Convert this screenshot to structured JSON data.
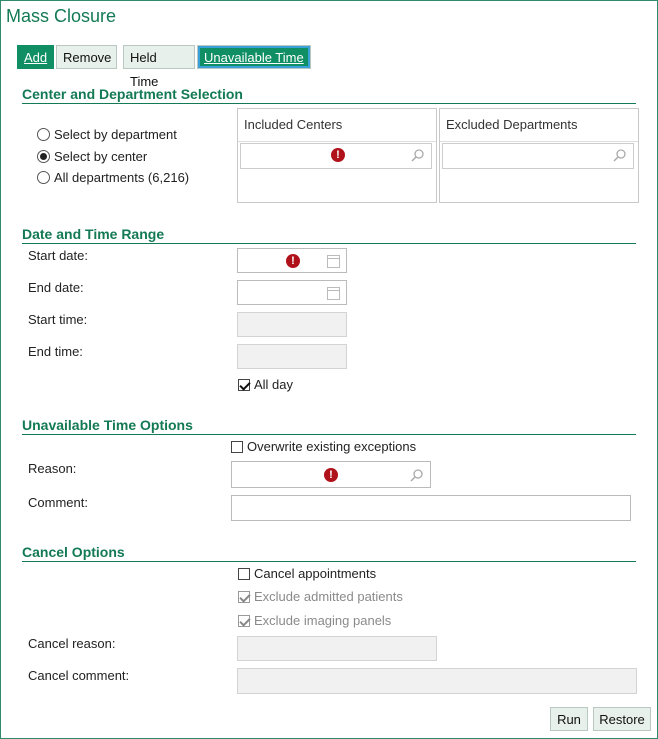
{
  "header": {
    "title": "Mass Closure"
  },
  "toolbar": {
    "add": "Add",
    "remove": "Remove",
    "held_time": "Held Time",
    "unavailable_time": "Unavailable Time"
  },
  "center_section": {
    "title": "Center and Department Selection",
    "radios": [
      "Select by department",
      "Select by center",
      "All departments (6,216)"
    ],
    "selected_radio": "Select by center",
    "included_header": "Included Centers",
    "excluded_header": "Excluded Departments"
  },
  "date_section": {
    "title": "Date and Time Range",
    "start_date": "Start date:",
    "end_date": "End date:",
    "start_time": "Start time:",
    "end_time": "End time:",
    "all_day": "All day",
    "all_day_checked": true
  },
  "unavail_section": {
    "title": "Unavailable Time Options",
    "overwrite": "Overwrite existing exceptions",
    "overwrite_checked": false,
    "reason": "Reason:",
    "comment": "Comment:"
  },
  "cancel_section": {
    "title": "Cancel Options",
    "cancel_appts": "Cancel appointments",
    "cancel_appts_checked": false,
    "exclude_admitted": "Exclude admitted patients",
    "exclude_admitted_checked": true,
    "exclude_imaging": "Exclude imaging panels",
    "exclude_imaging_checked": true,
    "cancel_reason": "Cancel reason:",
    "cancel_comment": "Cancel comment:"
  },
  "footer": {
    "run": "Run",
    "restore": "Restore"
  },
  "icons": {
    "required": "required-error-icon",
    "search": "search-icon",
    "calendar": "calendar-icon"
  },
  "colors": {
    "brand": "#137a55",
    "button_active": "#0f8f63",
    "required": "#b0121b"
  }
}
